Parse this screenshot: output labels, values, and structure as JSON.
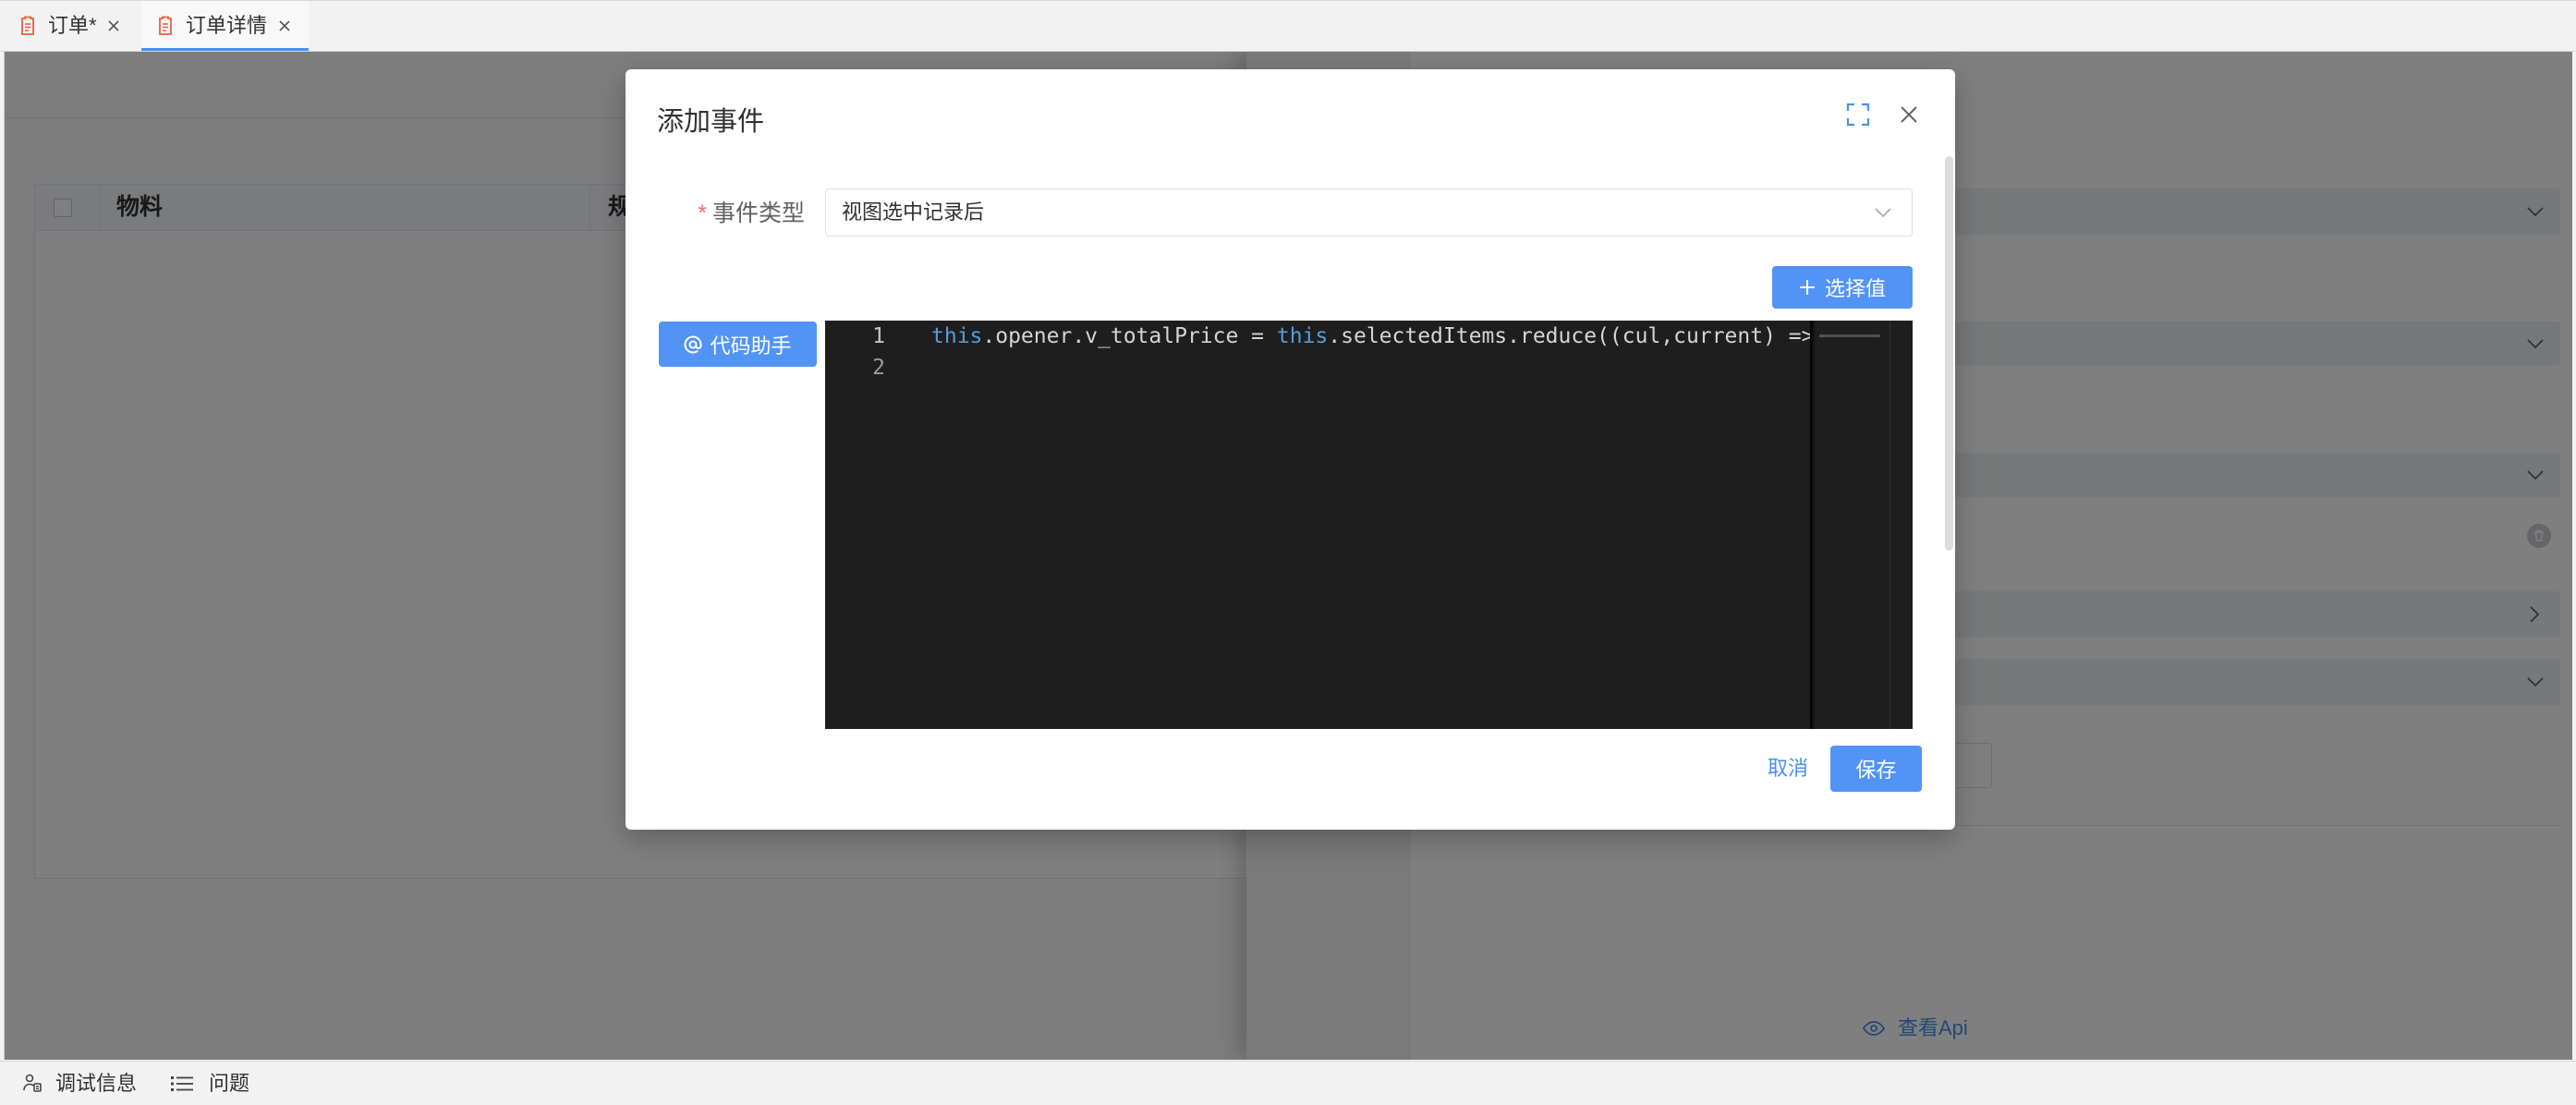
{
  "colors": {
    "primary": "#5294f5",
    "danger": "#f56c6c",
    "link": "#4a8ff0",
    "editor-bg": "#1e1e1e",
    "keyword": "#569cd6",
    "code-text": "#d4d4d4"
  },
  "tabs": [
    {
      "label": "订单*",
      "icon": "document-icon",
      "active": false
    },
    {
      "label": "订单详情",
      "icon": "document-icon",
      "active": true
    }
  ],
  "page": {
    "table": {
      "columns": [
        "物料",
        "规"
      ]
    }
  },
  "drawer": {
    "view_api_label": "查看Api",
    "view_api_icon": "eye-icon"
  },
  "modal": {
    "title": "添加事件",
    "field": {
      "required_mark": "*",
      "label": "事件类型",
      "value": "视图选中记录后"
    },
    "select_value_button": "选择值",
    "code_helper_button": "代码助手",
    "editor": {
      "lines": [
        {
          "number": "1",
          "tokens": [
            {
              "text": "this",
              "color": "#569cd6"
            },
            {
              "text": ".opener.v_totalPrice = ",
              "color": "#d4d4d4"
            },
            {
              "text": "this",
              "color": "#569cd6"
            },
            {
              "text": ".selectedItems.reduce((cul,current) =>",
              "color": "#d4d4d4"
            }
          ]
        },
        {
          "number": "2",
          "tokens": []
        }
      ]
    },
    "cancel_label": "取消",
    "save_label": "保存"
  },
  "statusbar": {
    "items": [
      {
        "label": "调试信息",
        "icon": "debug-icon"
      },
      {
        "label": "问题",
        "icon": "list-icon"
      }
    ]
  }
}
